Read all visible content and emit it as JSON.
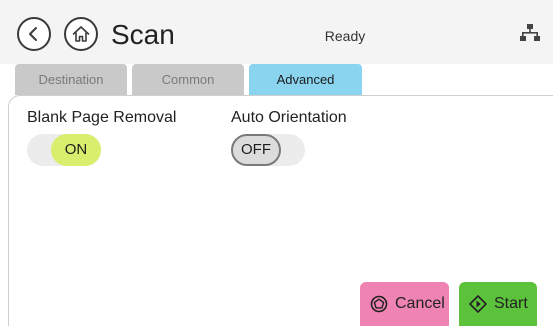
{
  "header": {
    "title": "Scan",
    "status": "Ready",
    "back_icon": "chevron-left-icon",
    "home_icon": "home-icon",
    "network_icon": "network-icon"
  },
  "tabs": [
    {
      "label": "Destination",
      "selected": false
    },
    {
      "label": "Common",
      "selected": false
    },
    {
      "label": "Advanced",
      "selected": true
    }
  ],
  "settings": {
    "blank_page_removal": {
      "label": "Blank Page Removal",
      "value": "ON",
      "state": true
    },
    "auto_orientation": {
      "label": "Auto Orientation",
      "value": "OFF",
      "state": false
    }
  },
  "actions": {
    "cancel": {
      "label": "Cancel",
      "icon": "stop-icon"
    },
    "start": {
      "label": "Start",
      "icon": "start-icon"
    }
  },
  "colors": {
    "tab_selected": "#8ad4f0",
    "tab_unselected": "#c9c9c9",
    "toggle_on": "#d8ee6c",
    "cancel": "#ef83b3",
    "start": "#5cc23c"
  }
}
